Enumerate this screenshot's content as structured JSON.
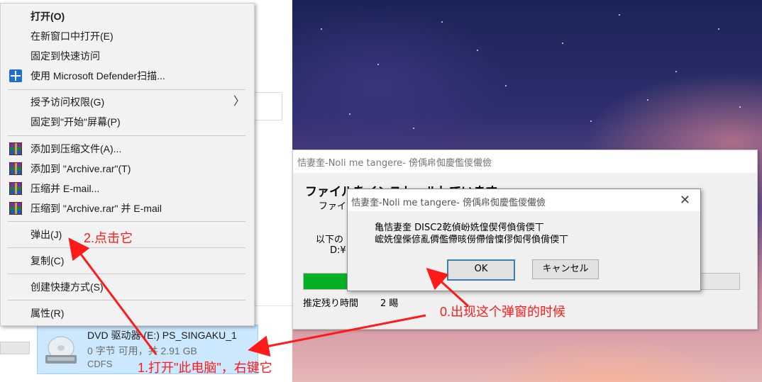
{
  "colors": {
    "annotation": "#ff1a1a",
    "selection": "#cce8ff",
    "progress": "#06b025"
  },
  "context_menu": {
    "items": [
      {
        "label": "打开(O)",
        "bold": true
      },
      {
        "label": "在新窗口中打开(E)"
      },
      {
        "label": "固定到快速访问"
      },
      {
        "label": "使用 Microsoft Defender扫描...",
        "icon": "shield-icon"
      },
      {
        "label": "授予访问权限(G)",
        "submenu": true
      },
      {
        "label": "固定到\"开始\"屏幕(P)"
      },
      {
        "label": "添加到压缩文件(A)...",
        "icon": "winrar-icon"
      },
      {
        "label": "添加到 \"Archive.rar\"(T)",
        "icon": "winrar-icon"
      },
      {
        "label": "压缩并 E-mail...",
        "icon": "winrar-icon"
      },
      {
        "label": "压缩到 \"Archive.rar\" 并 E-mail",
        "icon": "winrar-icon"
      },
      {
        "label": "弹出(J)"
      },
      {
        "label": "复制(C)"
      },
      {
        "label": "创建快捷方式(S)"
      },
      {
        "label": "属性(R)"
      }
    ]
  },
  "drive": {
    "name": "DVD 驱动器 (E:) PS_SINGAKU_1",
    "space": "0 字节 可用，共 2.91 GB",
    "fs": "CDFS"
  },
  "installer": {
    "title": "恄妻奎-Noli me tangere- 傍偊帍倁慶儖儍儎儉",
    "heading": "ファイルをインストールしています",
    "sub": "ファイ",
    "label1": "以下の",
    "label2": "D:¥1",
    "progress": 0.13,
    "est_label": "推定残り時間",
    "est_value": "2 睗"
  },
  "dialog": {
    "title": "恄妻奎-Noli me tangere- 傍偊帍倁慶儖儍儎儉",
    "line1": "亀恄妻奎 DISC2乾偵岎姺偟偰偔偩偝偄丅",
    "line2": "峵姺偟偨偐亂僲儖僀晐僗僀儈懍僇倁偔偩偝偄丅",
    "ok": "OK",
    "cancel": "キャンセル"
  },
  "annotations": {
    "step0": "0.出现这个弹窗的时候",
    "step1": "1.打开\"此电脑\"，右键它",
    "step2": "2.点击它"
  }
}
